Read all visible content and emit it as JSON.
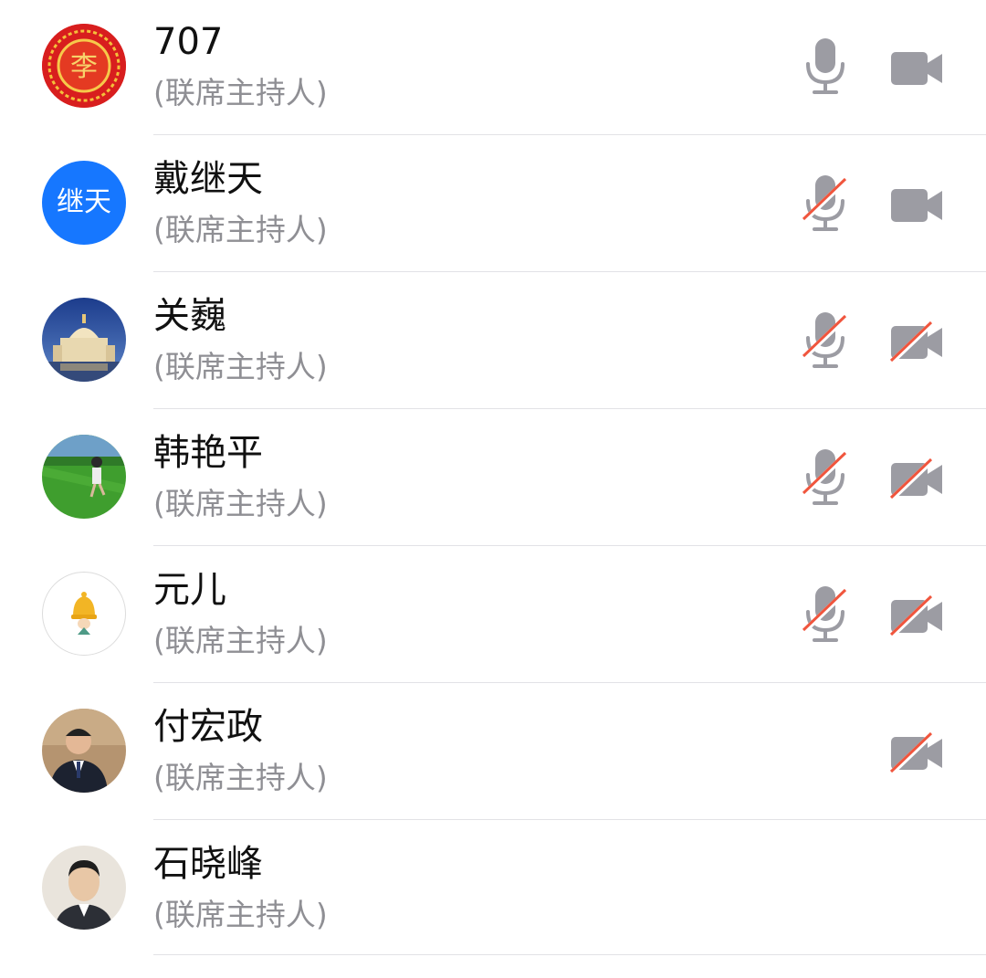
{
  "participants": [
    {
      "name": "707",
      "role": "(联席主持人)",
      "avatar": {
        "kind": "seal",
        "text": "李",
        "bg": "#d81e1e"
      },
      "mic": "on",
      "cam": "on"
    },
    {
      "name": "戴继天",
      "role": "(联席主持人)",
      "avatar": {
        "kind": "text",
        "text": "继天",
        "bg": "#1677ff"
      },
      "mic": "off",
      "cam": "on"
    },
    {
      "name": "关巍",
      "role": "(联席主持人)",
      "avatar": {
        "kind": "photo-cathedral"
      },
      "mic": "off",
      "cam": "off"
    },
    {
      "name": "韩艳平",
      "role": "(联席主持人)",
      "avatar": {
        "kind": "photo-grass"
      },
      "mic": "off",
      "cam": "off"
    },
    {
      "name": "元儿",
      "role": "(联席主持人)",
      "avatar": {
        "kind": "photo-bell"
      },
      "mic": "off",
      "cam": "off"
    },
    {
      "name": "付宏政",
      "role": "(联席主持人)",
      "avatar": {
        "kind": "photo-man"
      },
      "mic": "none",
      "cam": "off"
    },
    {
      "name": "石晓峰",
      "role": "(联席主持人)",
      "avatar": {
        "kind": "photo-figurine"
      },
      "mic": "none",
      "cam": "none"
    }
  ],
  "icons": {
    "mic_on": "microphone-icon",
    "mic_off": "microphone-muted-icon",
    "cam_on": "video-camera-icon",
    "cam_off": "video-camera-off-icon"
  },
  "colors": {
    "icon_gray": "#9c9ca3",
    "mute_slash": "#f0553d",
    "name_text": "#111111",
    "role_text": "#8f8f94",
    "divider": "#e2e2e6"
  }
}
